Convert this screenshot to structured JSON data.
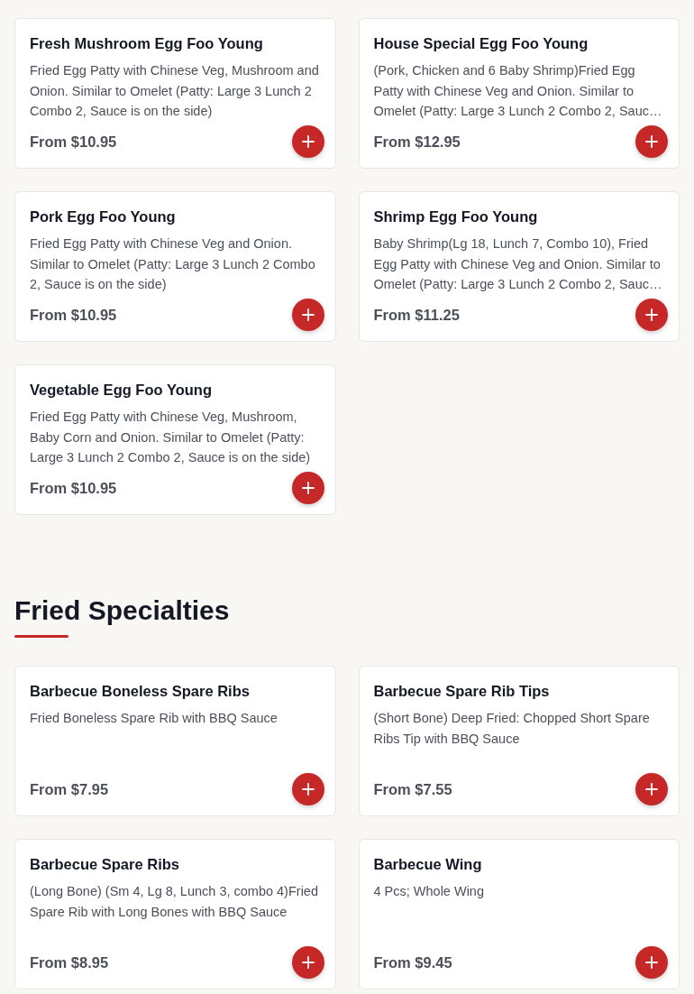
{
  "sections": [
    {
      "items": [
        {
          "name": "Fresh Mushroom Egg Foo Young",
          "description": "Fried Egg Patty with Chinese Veg, Mushroom and Onion. Similar to Omelet (Patty: Large 3 Lunch 2 Combo 2, Sauce is on the side)",
          "price": "From $10.95"
        },
        {
          "name": "House Special Egg Foo Young",
          "description": "(Pork, Chicken and 6 Baby Shrimp)Fried Egg Patty with Chinese Veg and Onion. Similar to Omelet (Patty: Large 3 Lunch 2 Combo 2, Sauc…",
          "price": "From $12.95"
        },
        {
          "name": "Pork Egg Foo Young",
          "description": "Fried Egg Patty with Chinese Veg and Onion. Similar to Omelet (Patty: Large 3 Lunch 2 Combo 2, Sauce is on the side)",
          "price": "From $10.95"
        },
        {
          "name": "Shrimp Egg Foo Young",
          "description": "Baby Shrimp(Lg 18, Lunch 7, Combo 10), Fried Egg Patty with Chinese Veg and Onion. Similar to Omelet (Patty: Large 3 Lunch 2 Combo 2, Sauc…",
          "price": "From $11.25"
        },
        {
          "name": "Vegetable Egg Foo Young",
          "description": "Fried Egg Patty with Chinese Veg, Mushroom, Baby Corn and Onion. Similar to Omelet (Patty: Large 3 Lunch 2 Combo 2, Sauce is on the side)",
          "price": "From $10.95"
        }
      ]
    },
    {
      "title": "Fried Specialties",
      "items": [
        {
          "name": "Barbecue Boneless Spare Ribs",
          "description": "Fried Boneless Spare Rib with BBQ Sauce",
          "price": "From $7.95"
        },
        {
          "name": "Barbecue Spare Rib Tips",
          "description": "(Short Bone) Deep Fried: Chopped Short Spare Ribs Tip with BBQ Sauce",
          "price": "From $7.55"
        },
        {
          "name": "Barbecue Spare Ribs",
          "description": "(Long Bone) (Sm 4, Lg 8, Lunch 3, combo 4)Fried Spare Rib with Long Bones with BBQ Sauce",
          "price": "From $8.95"
        },
        {
          "name": "Barbecue Wing",
          "description": "4 Pcs; Whole Wing",
          "price": "From $9.45"
        }
      ]
    }
  ]
}
